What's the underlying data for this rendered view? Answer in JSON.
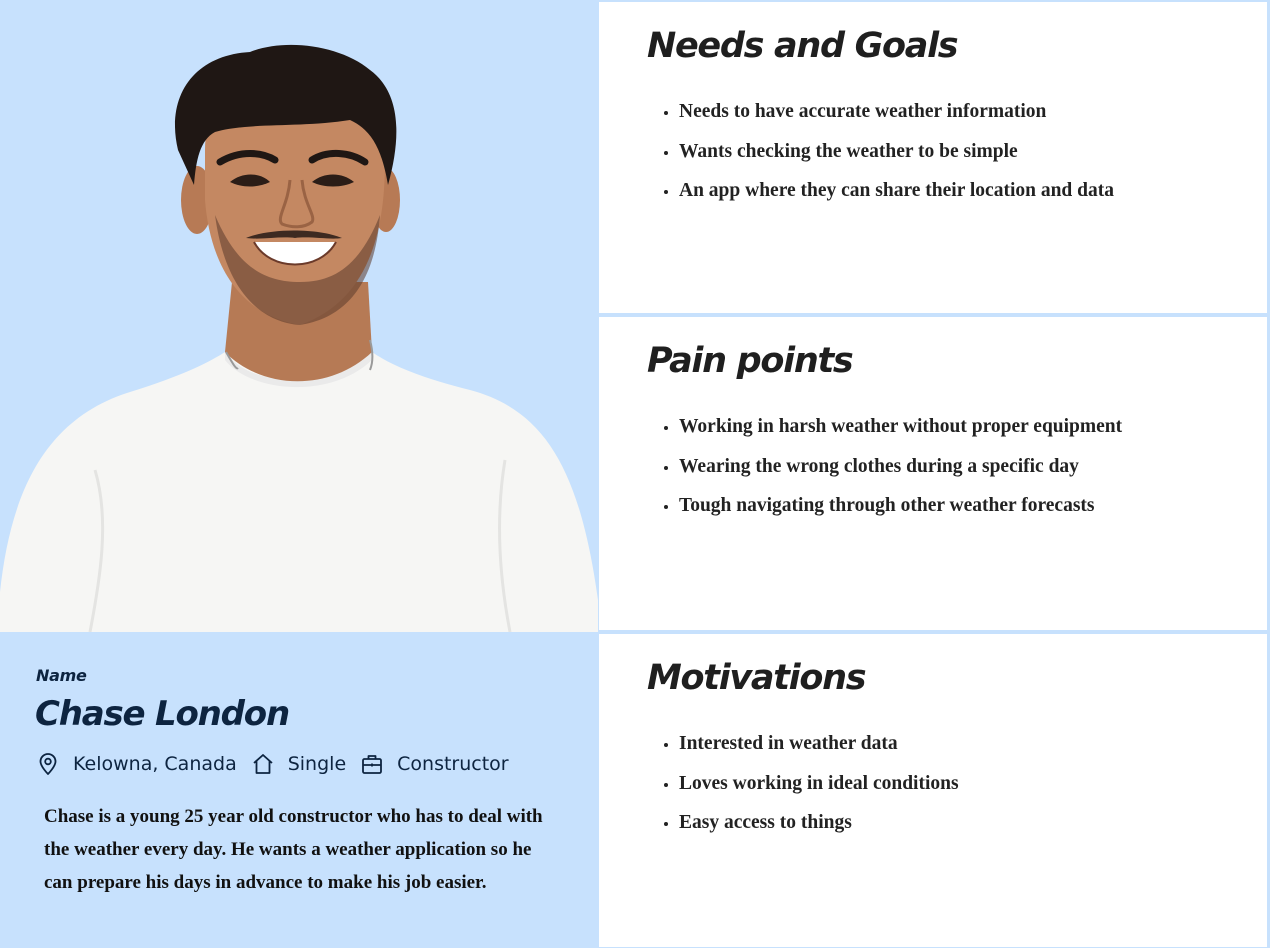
{
  "persona": {
    "name_label": "Name",
    "name": "Chase London",
    "location": "Kelowna, Canada",
    "status": "Single",
    "occupation": "Constructor",
    "bio": "Chase is a young 25 year old constructor who has to deal with the weather every day.  He wants a weather application so he can prepare his days in advance to make his job easier.",
    "icons": {
      "location": "location-pin-icon",
      "status": "home-icon",
      "occupation": "briefcase-icon"
    }
  },
  "sections": {
    "needs": {
      "title": "Needs and Goals",
      "items": [
        "Needs to have accurate weather information",
        "Wants checking the weather to be simple",
        "An app where they can share their location and data"
      ]
    },
    "pain": {
      "title": "Pain points",
      "items": [
        "Working in harsh weather without proper equipment",
        "Wearing the wrong clothes during a specific day",
        "Tough navigating through other weather forecasts"
      ]
    },
    "motivations": {
      "title": "Motivations",
      "items": [
        "Interested in weather data",
        "Loves working in ideal conditions",
        "Easy access to things"
      ]
    }
  },
  "colors": {
    "background": "#c7e1fd",
    "card": "#ffffff",
    "name_text": "#0d2440",
    "heading_text": "#1f1f1f"
  }
}
